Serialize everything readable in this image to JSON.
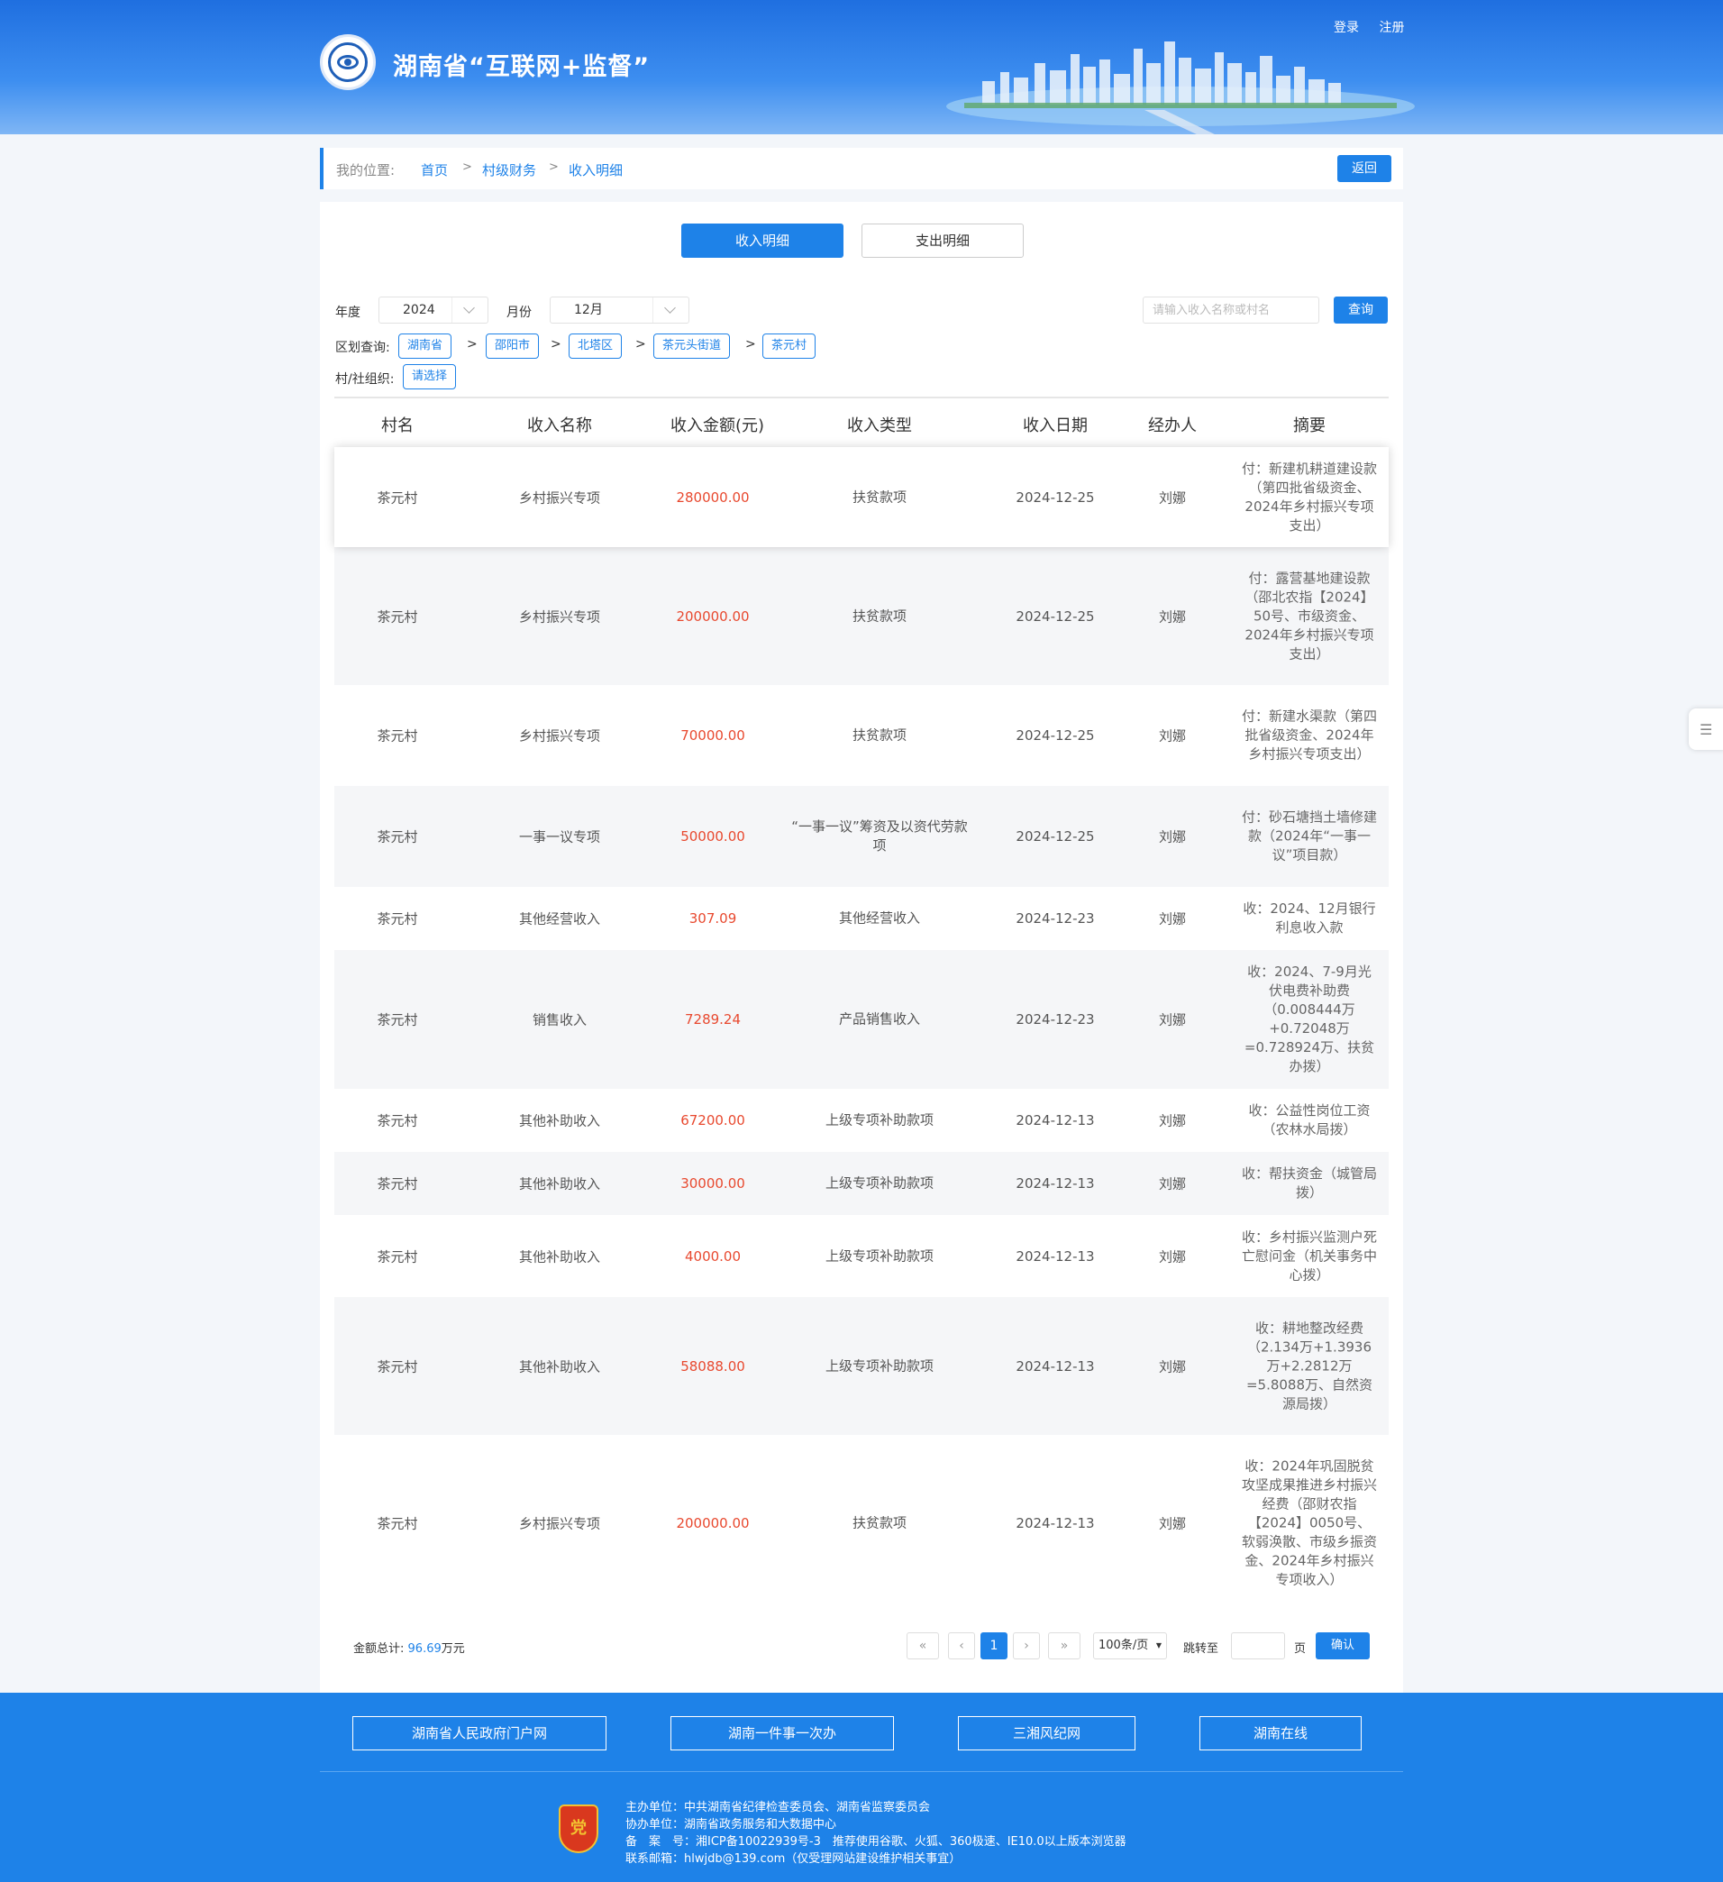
{
  "header": {
    "title": "湖南省“互联网+监督”",
    "login": "登录",
    "register": "注册"
  },
  "breadcrumb": {
    "position_label": "我的位置:",
    "items": [
      "首页",
      "村级财务",
      "收入明细"
    ],
    "separator": ">",
    "back": "返回"
  },
  "tabs": [
    "收入明细",
    "支出明细"
  ],
  "filters": {
    "year_label": "年度",
    "year_value": "2024",
    "month_label": "月份",
    "month_value": "12月",
    "search_placeholder": "请输入收入名称或村名",
    "query_button": "查询",
    "region_label": "区划查询:",
    "regions": [
      "湖南省",
      "邵阳市",
      "北塔区",
      "茶元头街道",
      "茶元村"
    ],
    "region_separator": ">",
    "village_label": "村/社组织:",
    "village_placeholder": "请选择"
  },
  "table": {
    "columns": [
      "村名",
      "收入名称",
      "收入金额(元)",
      "收入类型",
      "收入日期",
      "经办人",
      "摘要"
    ],
    "rows": [
      {
        "village": "茶元村",
        "name": "乡村振兴专项",
        "amount": "280000.00",
        "type": "扶贫款项",
        "date": "2024-12-25",
        "handler": "刘娜",
        "summary": "付：新建机耕道建设款（第四批省级资金、2024年乡村振兴专项支出）"
      },
      {
        "village": "茶元村",
        "name": "乡村振兴专项",
        "amount": "200000.00",
        "type": "扶贫款项",
        "date": "2024-12-25",
        "handler": "刘娜",
        "summary": "付：露营基地建设款（邵北农指【2024】50号、市级资金、2024年乡村振兴专项支出）"
      },
      {
        "village": "茶元村",
        "name": "乡村振兴专项",
        "amount": "70000.00",
        "type": "扶贫款项",
        "date": "2024-12-25",
        "handler": "刘娜",
        "summary": "付：新建水渠款（第四批省级资金、2024年乡村振兴专项支出）"
      },
      {
        "village": "茶元村",
        "name": "一事一议专项",
        "amount": "50000.00",
        "type": "“一事一议”筹资及以资代劳款项",
        "date": "2024-12-25",
        "handler": "刘娜",
        "summary": "付：砂石塘挡土墙修建款（2024年“一事一议”项目款）"
      },
      {
        "village": "茶元村",
        "name": "其他经营收入",
        "amount": "307.09",
        "type": "其他经营收入",
        "date": "2024-12-23",
        "handler": "刘娜",
        "summary": "收：2024、12月银行利息收入款"
      },
      {
        "village": "茶元村",
        "name": "销售收入",
        "amount": "7289.24",
        "type": "产品销售收入",
        "date": "2024-12-23",
        "handler": "刘娜",
        "summary": "收：2024、7-9月光伏电费补助费（0.008444万+0.72048万=0.728924万、扶贫办拨）"
      },
      {
        "village": "茶元村",
        "name": "其他补助收入",
        "amount": "67200.00",
        "type": "上级专项补助款项",
        "date": "2024-12-13",
        "handler": "刘娜",
        "summary": "收：公益性岗位工资（农林水局拨）"
      },
      {
        "village": "茶元村",
        "name": "其他补助收入",
        "amount": "30000.00",
        "type": "上级专项补助款项",
        "date": "2024-12-13",
        "handler": "刘娜",
        "summary": "收：帮扶资金（城管局拨）"
      },
      {
        "village": "茶元村",
        "name": "其他补助收入",
        "amount": "4000.00",
        "type": "上级专项补助款项",
        "date": "2024-12-13",
        "handler": "刘娜",
        "summary": "收：乡村振兴监测户死亡慰问金（机关事务中心拨）"
      },
      {
        "village": "茶元村",
        "name": "其他补助收入",
        "amount": "58088.00",
        "type": "上级专项补助款项",
        "date": "2024-12-13",
        "handler": "刘娜",
        "summary": "收：耕地整改经费（2.134万+1.3936万+2.2812万=5.8088万、自然资源局拨）"
      },
      {
        "village": "茶元村",
        "name": "乡村振兴专项",
        "amount": "200000.00",
        "type": "扶贫款项",
        "date": "2024-12-13",
        "handler": "刘娜",
        "summary": "收：2024年巩固脱贫攻坚成果推进乡村振兴经费（邵财农指【2024】0050号、软弱涣散、市级乡振资金、2024年乡村振兴专项收入）"
      }
    ]
  },
  "totals": {
    "label": "金额总计:",
    "value": "96.69",
    "unit": "万元"
  },
  "pagination": {
    "first": "«",
    "prev": "‹",
    "current": "1",
    "next": "›",
    "last": "»",
    "per_page": "100条/页",
    "jump_label": "跳转至",
    "page_unit": "页",
    "confirm": "确认"
  },
  "side_tab_icon": "list-icon",
  "footer": {
    "links": [
      "湖南省人民政府门户网",
      "湖南一件事一次办",
      "三湘风纪网",
      "湖南在线"
    ],
    "emblem_text": "党政机关",
    "info": [
      "主办单位：中共湖南省纪律检查委员会、湖南省监察委员会",
      "协办单位：湖南省政务服务和大数据中心",
      "备　案　号：湘ICP备10022939号-3　推荐使用谷歌、火狐、360极速、IE10.0以上版本浏览器",
      "联系邮箱：hlwjdb@139.com（仅受理网站建设维护相关事宜）"
    ]
  }
}
